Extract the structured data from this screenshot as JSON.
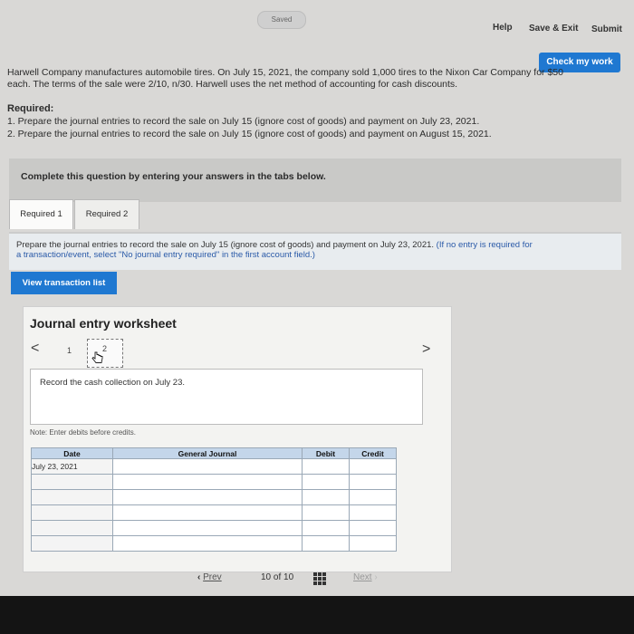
{
  "header": {
    "saved_label": "Saved",
    "help_label": "Help",
    "save_exit_label": "Save & Exit",
    "submit_label": "Submit",
    "check_label": "Check my work"
  },
  "problem": {
    "intro_line1": "Harwell Company manufactures automobile tires. On July 15, 2021, the company sold 1,000 tires to the Nixon Car Company for $50",
    "intro_line2": "each. The terms of the sale were 2/10, n/30. Harwell uses the net method of accounting for cash discounts.",
    "required_title": "Required:",
    "required_items": [
      "1. Prepare the journal entries to record the sale on July 15 (ignore cost of goods) and payment on July 23, 2021.",
      "2. Prepare the journal entries to record the sale on July 15 (ignore cost of goods) and payment on August 15, 2021."
    ]
  },
  "complete_prompt": "Complete this question by entering your answers in the tabs below.",
  "tabs": [
    {
      "label": "Required 1",
      "active": true
    },
    {
      "label": "Required 2",
      "active": false
    }
  ],
  "instructions": {
    "main": "Prepare the journal entries to record the sale on July 15 (ignore cost of goods) and payment on July 23, 2021.",
    "hint_line1": "(If no entry is required for",
    "hint_line2": "a transaction/event, select \"No journal entry required\" in the first account field.)"
  },
  "view_transaction_label": "View transaction list",
  "worksheet": {
    "title": "Journal entry worksheet",
    "prev_arrow": "<",
    "next_arrow": ">",
    "pages": [
      "1",
      "2"
    ],
    "current_page": "2",
    "record_text": "Record the cash collection on July 23.",
    "note": "Note: Enter debits before credits.",
    "columns": [
      "Date",
      "General Journal",
      "Debit",
      "Credit"
    ],
    "rows": [
      {
        "date": "July 23, 2021",
        "account": "",
        "debit": "",
        "credit": ""
      },
      {
        "date": "",
        "account": "",
        "debit": "",
        "credit": ""
      },
      {
        "date": "",
        "account": "",
        "debit": "",
        "credit": ""
      },
      {
        "date": "",
        "account": "",
        "debit": "",
        "credit": ""
      },
      {
        "date": "",
        "account": "",
        "debit": "",
        "credit": ""
      },
      {
        "date": "",
        "account": "",
        "debit": "",
        "credit": ""
      }
    ]
  },
  "pagination": {
    "prev_label": "Prev",
    "current": "10",
    "of_label": "of",
    "total": "10",
    "next_label": "Next"
  },
  "colors": {
    "accent": "#1f78d1",
    "table_header": "#c4d6ea"
  }
}
